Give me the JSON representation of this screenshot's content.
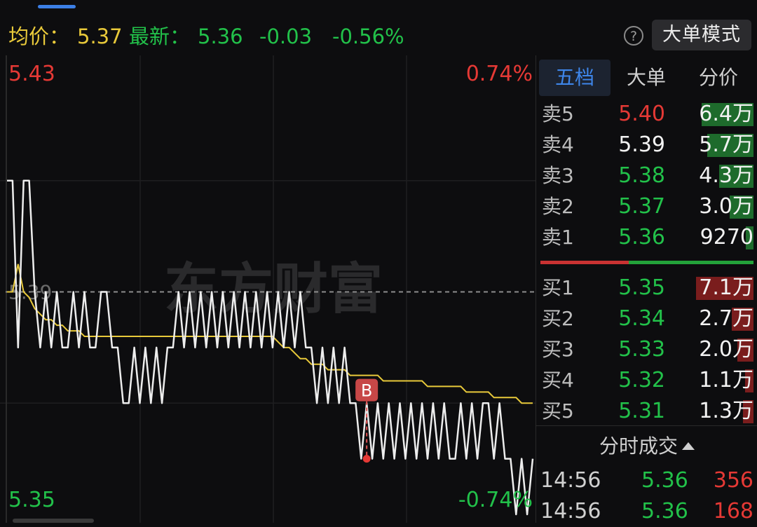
{
  "header": {
    "avg_label": "均价：",
    "avg_value": "5.37",
    "latest_label": "最新：",
    "latest_value": "5.36",
    "change": "-0.03",
    "change_pct": "-0.56%",
    "help_icon": "?",
    "mode_button": "大单模式"
  },
  "chart": {
    "price_high": "5.43",
    "price_low": "5.35",
    "pct_high": "0.74%",
    "pct_low": "-0.74%",
    "ref_price": "5.39",
    "watermark": "东方财富",
    "marker_label": "B",
    "colors": {
      "price_line": "#ededed",
      "avg_line": "#e8c93a",
      "up": "#e53935",
      "down": "#22c14a"
    }
  },
  "chart_data": {
    "type": "line",
    "title": "",
    "xlabel": "",
    "ylabel": "",
    "ylim": [
      5.35,
      5.43
    ],
    "reference": 5.39,
    "grid": true,
    "series": [
      {
        "name": "",
        "values": [
          5.41,
          5.41,
          5.38,
          5.41,
          5.41,
          5.39,
          5.38,
          5.39,
          5.38,
          5.39,
          5.38,
          5.38,
          5.39,
          5.38,
          5.39,
          5.38,
          5.38,
          5.39,
          5.39,
          5.38,
          5.38,
          5.37,
          5.37,
          5.38,
          5.37,
          5.38,
          5.37,
          5.38,
          5.37,
          5.38,
          5.38,
          5.39,
          5.38,
          5.39,
          5.38,
          5.39,
          5.38,
          5.39,
          5.38,
          5.39,
          5.38,
          5.39,
          5.38,
          5.39,
          5.38,
          5.39,
          5.38,
          5.39,
          5.38,
          5.39,
          5.38,
          5.39,
          5.38,
          5.39,
          5.38,
          5.38,
          5.37,
          5.38,
          5.37,
          5.38,
          5.37,
          5.38,
          5.37,
          5.37,
          5.36,
          5.37,
          5.36,
          5.37,
          5.36,
          5.37,
          5.36,
          5.37,
          5.36,
          5.37,
          5.36,
          5.37,
          5.36,
          5.37,
          5.36,
          5.37,
          5.36,
          5.36,
          5.37,
          5.36,
          5.37,
          5.36,
          5.37,
          5.37,
          5.36,
          5.37,
          5.36,
          5.36,
          5.35,
          5.36,
          5.35,
          5.36
        ]
      },
      {
        "name": "",
        "values": [
          5.39,
          5.39,
          5.395,
          5.39,
          5.389,
          5.387,
          5.386,
          5.385,
          5.385,
          5.384,
          5.384,
          5.383,
          5.383,
          5.383,
          5.382,
          5.382,
          5.382,
          5.382,
          5.382,
          5.382,
          5.382,
          5.382,
          5.382,
          5.382,
          5.382,
          5.382,
          5.382,
          5.382,
          5.382,
          5.382,
          5.382,
          5.382,
          5.382,
          5.382,
          5.382,
          5.382,
          5.382,
          5.382,
          5.382,
          5.382,
          5.382,
          5.382,
          5.382,
          5.382,
          5.382,
          5.382,
          5.382,
          5.382,
          5.382,
          5.381,
          5.38,
          5.38,
          5.379,
          5.378,
          5.378,
          5.377,
          5.377,
          5.377,
          5.376,
          5.376,
          5.376,
          5.376,
          5.375,
          5.375,
          5.375,
          5.375,
          5.375,
          5.375,
          5.374,
          5.374,
          5.374,
          5.374,
          5.374,
          5.374,
          5.374,
          5.374,
          5.373,
          5.373,
          5.373,
          5.373,
          5.373,
          5.373,
          5.373,
          5.372,
          5.372,
          5.372,
          5.372,
          5.372,
          5.371,
          5.371,
          5.371,
          5.371,
          5.371,
          5.37,
          5.37,
          5.37
        ]
      }
    ],
    "marker": {
      "label": "B",
      "index": 65,
      "value": 5.36
    }
  },
  "tabs": [
    "五档",
    "大单",
    "分价"
  ],
  "asks": [
    {
      "label": "卖5",
      "price": "5.40",
      "vol": "6.4万",
      "price_color": "#e53935",
      "ratio": 0.9
    },
    {
      "label": "卖4",
      "price": "5.39",
      "vol": "5.7万",
      "price_color": "#f2f2f2",
      "ratio": 0.8
    },
    {
      "label": "卖3",
      "price": "5.38",
      "vol": "4.3万",
      "price_color": "#22c14a",
      "ratio": 0.6
    },
    {
      "label": "卖2",
      "price": "5.37",
      "vol": "3.0万",
      "price_color": "#22c14a",
      "ratio": 0.42
    },
    {
      "label": "卖1",
      "price": "5.36",
      "vol": "9270",
      "price_color": "#22c14a",
      "ratio": 0.13
    }
  ],
  "bids": [
    {
      "label": "买1",
      "price": "5.35",
      "vol": "7.1万",
      "price_color": "#22c14a",
      "ratio": 1.0
    },
    {
      "label": "买2",
      "price": "5.34",
      "vol": "2.7万",
      "price_color": "#22c14a",
      "ratio": 0.38
    },
    {
      "label": "买3",
      "price": "5.33",
      "vol": "2.0万",
      "price_color": "#22c14a",
      "ratio": 0.28
    },
    {
      "label": "买4",
      "price": "5.32",
      "vol": "1.1万",
      "price_color": "#22c14a",
      "ratio": 0.15
    },
    {
      "label": "买5",
      "price": "5.31",
      "vol": "1.3万",
      "price_color": "#22c14a",
      "ratio": 0.18
    }
  ],
  "trades_title": "分时成交",
  "trades": [
    {
      "time": "14:56",
      "price": "5.36",
      "vol": "356"
    },
    {
      "time": "14:56",
      "price": "5.36",
      "vol": "168"
    }
  ]
}
